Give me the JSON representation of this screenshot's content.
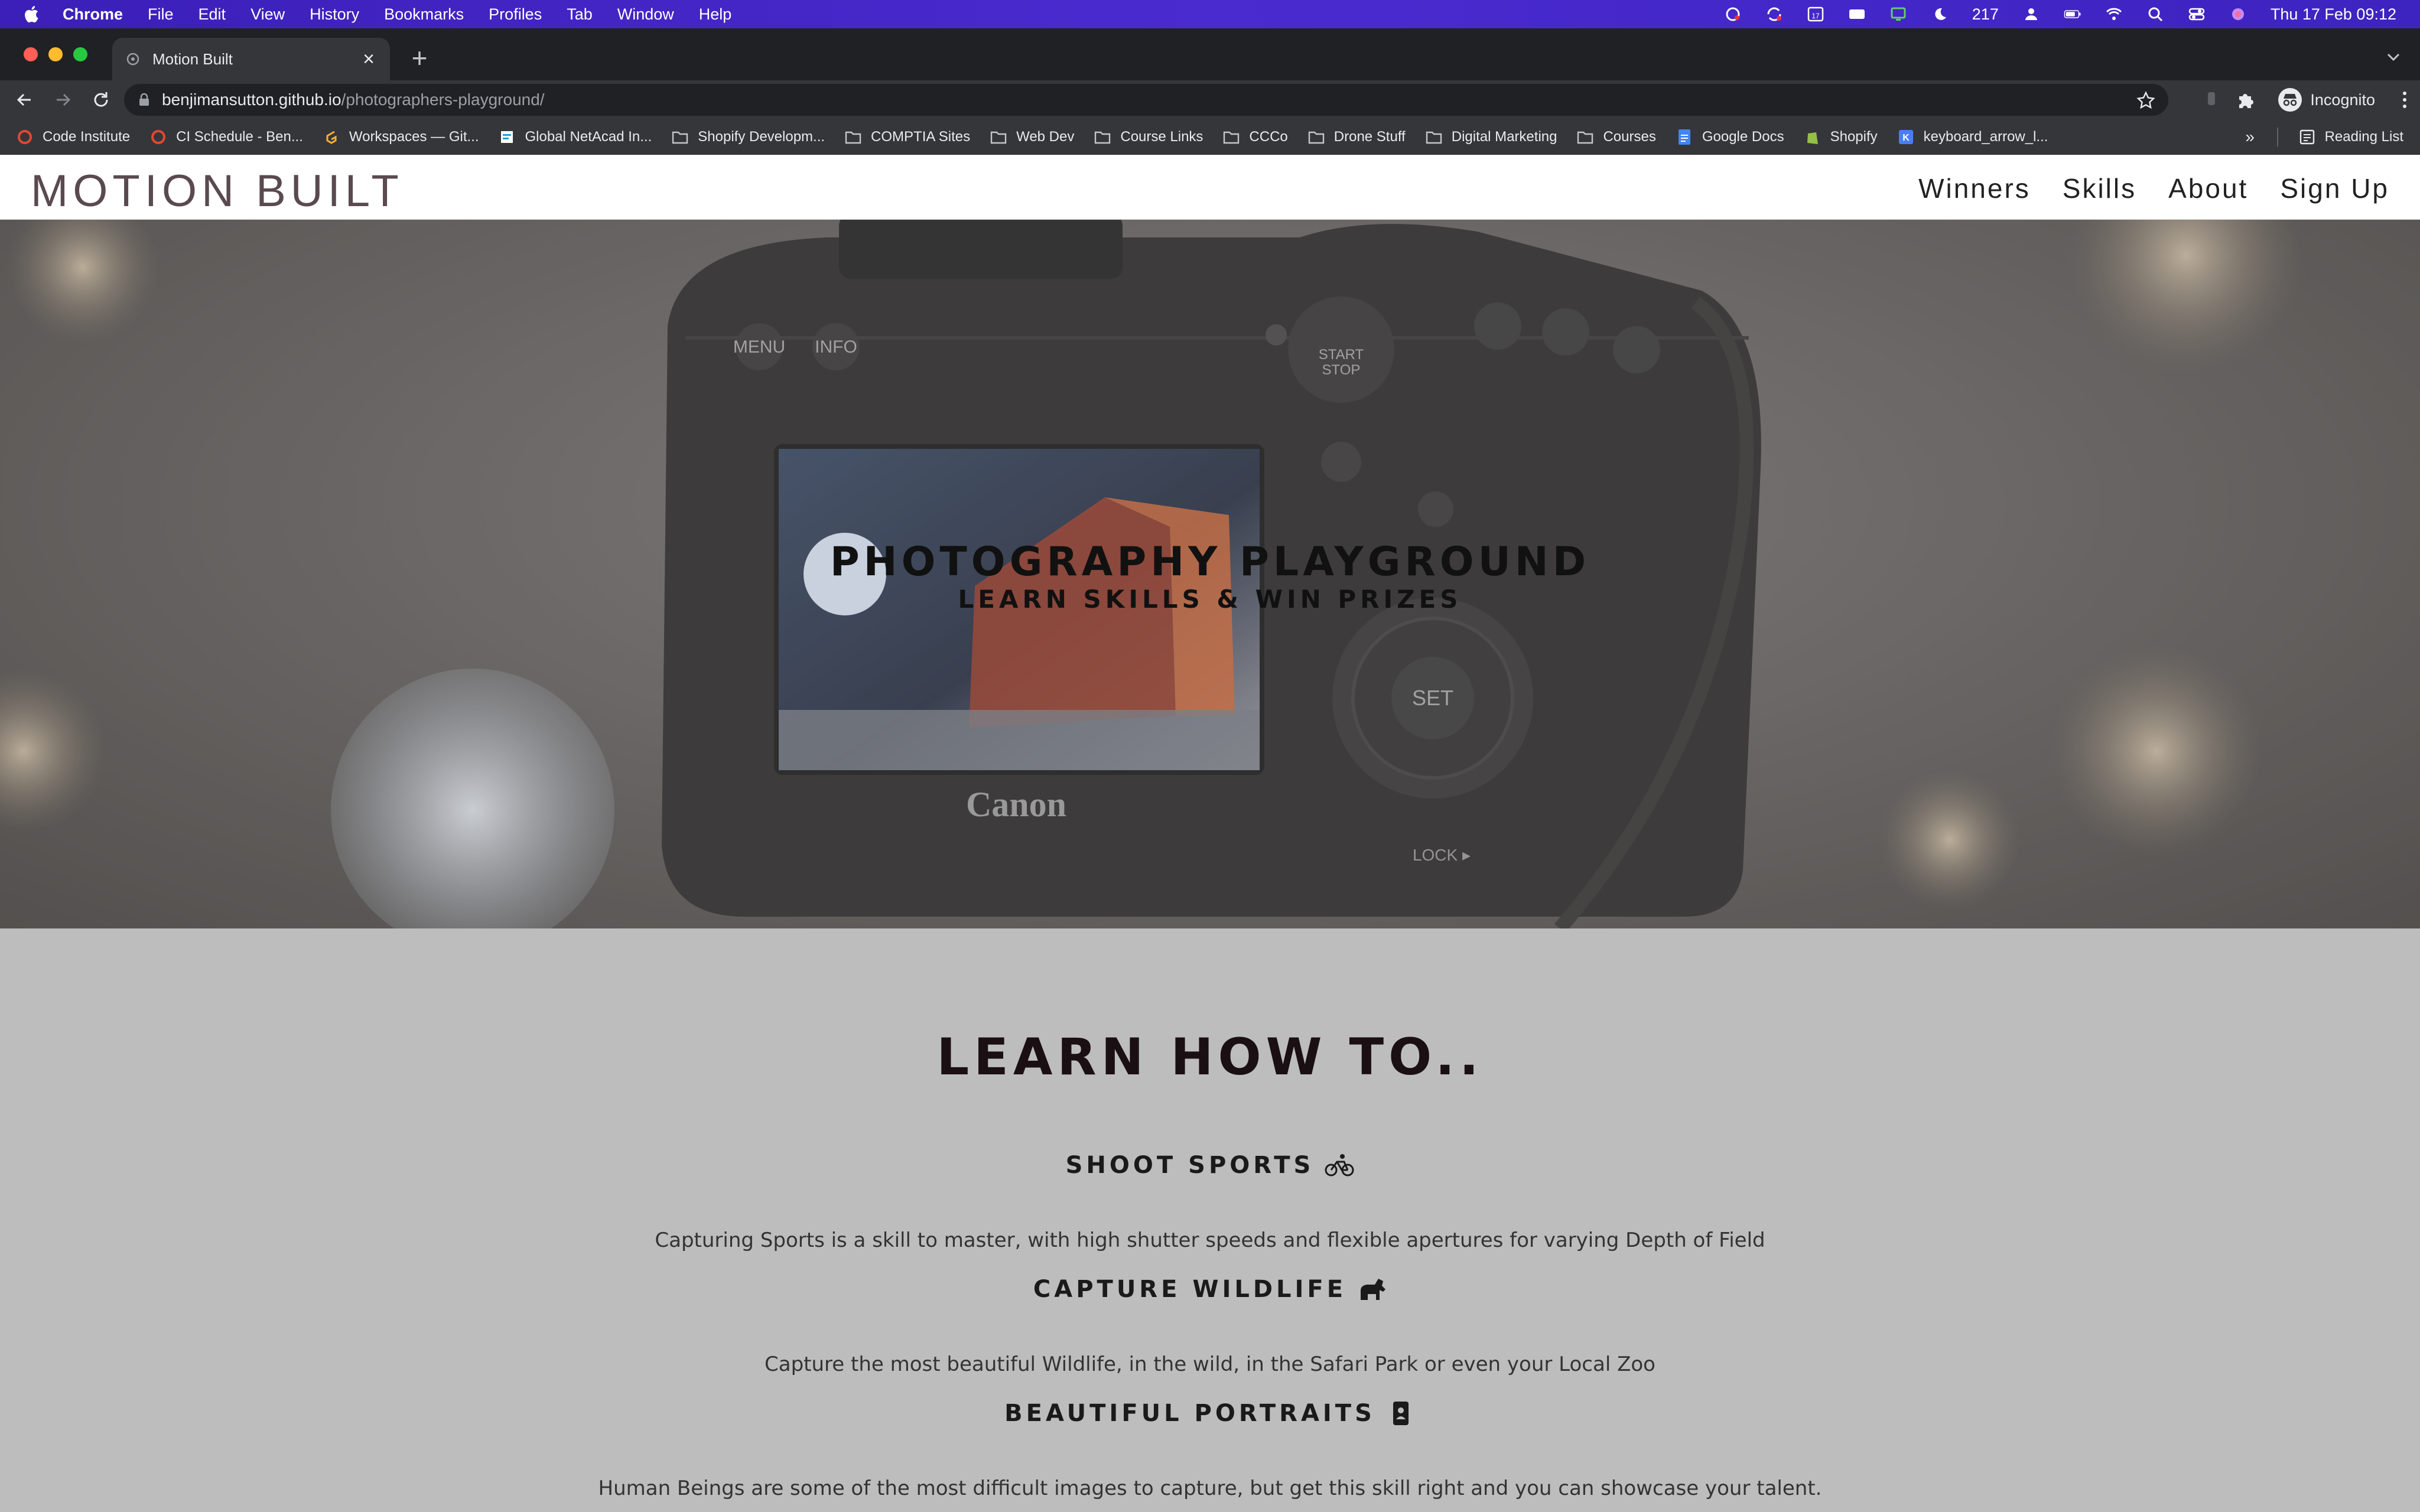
{
  "menubar": {
    "app": "Chrome",
    "items": [
      "File",
      "Edit",
      "View",
      "History",
      "Bookmarks",
      "Profiles",
      "Tab",
      "Window",
      "Help"
    ],
    "status_number": "217",
    "datetime": "Thu 17 Feb  09:12",
    "accent": "#4a2bd0"
  },
  "tab": {
    "title": "Motion Built",
    "close_symbol": "×",
    "new_tab_symbol": "+"
  },
  "omnibox": {
    "host": "benjimansutton.github.io",
    "path": "/photographers-playground/"
  },
  "profile": {
    "label": "Incognito"
  },
  "bookmarks": {
    "items": [
      {
        "label": "Code Institute",
        "icon": "code-institute-icon"
      },
      {
        "label": "CI Schedule - Ben...",
        "icon": "code-institute-icon"
      },
      {
        "label": "Workspaces — Git...",
        "icon": "gitpod-icon"
      },
      {
        "label": "Global NetAcad In...",
        "icon": "netacad-icon"
      },
      {
        "label": "Shopify Developm...",
        "icon": "folder-icon"
      },
      {
        "label": "COMPTIA Sites",
        "icon": "folder-icon"
      },
      {
        "label": "Web Dev",
        "icon": "folder-icon"
      },
      {
        "label": "Course Links",
        "icon": "folder-icon"
      },
      {
        "label": "CCCo",
        "icon": "folder-icon"
      },
      {
        "label": "Drone Stuff",
        "icon": "folder-icon"
      },
      {
        "label": "Digital Marketing",
        "icon": "folder-icon"
      },
      {
        "label": "Courses",
        "icon": "folder-icon"
      },
      {
        "label": "Google Docs",
        "icon": "google-docs-icon"
      },
      {
        "label": "Shopify",
        "icon": "shopify-icon"
      },
      {
        "label": "keyboard_arrow_l...",
        "icon": "k-icon"
      }
    ],
    "more": "»",
    "reading_list": "Reading List"
  },
  "site": {
    "brand": "MOTION BUILT",
    "nav": [
      "Winners",
      "Skills",
      "About",
      "Sign Up"
    ],
    "hero_title": "PHOTOGRAPHY PLAYGROUND",
    "hero_subtitle": "LEARN SKILLS & WIN PRIZES",
    "camera_labels": {
      "menu": "MENU",
      "info": "INFO",
      "start": "START",
      "stop": "STOP",
      "set": "SET",
      "lock": "LOCK ▸",
      "brand": "Canon"
    },
    "learn_title": "LEARN HOW TO..",
    "skills": [
      {
        "title": "SHOOT SPORTS",
        "icon": "bicycle-icon",
        "desc": "Capturing Sports is a skill to master, with high shutter speeds and flexible apertures for varying Depth of Field"
      },
      {
        "title": "CAPTURE WILDLIFE",
        "icon": "horse-icon",
        "desc": "Capture the most beautiful Wildlife, in the wild, in the Safari Park or even your Local Zoo"
      },
      {
        "title": "BEAUTIFUL PORTRAITS",
        "icon": "portrait-icon",
        "desc": "Human Beings are some of the most difficult images to capture, but get this skill right and you can showcase your talent."
      }
    ]
  }
}
